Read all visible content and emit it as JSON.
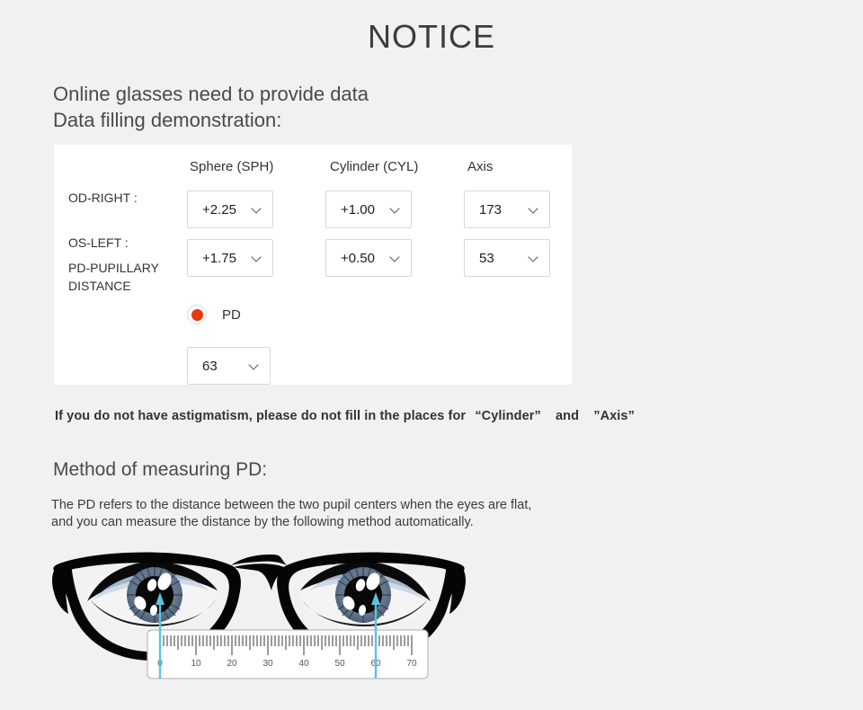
{
  "title": "NOTICE",
  "intro": {
    "line1": "Online glasses need to provide data",
    "line2": "Data filling demonstration:"
  },
  "prescription_form": {
    "columns": [
      {
        "key": "sph",
        "label": "Sphere (SPH)"
      },
      {
        "key": "cyl",
        "label": "Cylinder (CYL)"
      },
      {
        "key": "axis",
        "label": "Axis"
      }
    ],
    "rows": [
      {
        "label": "OD-RIGHT :",
        "sph": "+2.25",
        "cyl": "+1.00",
        "axis": "173"
      },
      {
        "label": "OS-LEFT :",
        "sph": "+1.75",
        "cyl": "+0.50",
        "axis": "53"
      }
    ],
    "pd": {
      "label": "PD-PUPILLARY DISTANCE",
      "radio_label": "PD",
      "radio_selected": true,
      "radio_color": "#e8380d",
      "value": "63"
    },
    "dropdown_icon": "chevron-down-icon",
    "panel_background": "#ffffff"
  },
  "note": {
    "text_before": "If you do not have astigmatism, please do not fill in the places for",
    "quoted_first": "“Cylinder”",
    "conjunction": "and",
    "quoted_second": "”Axis”"
  },
  "method": {
    "heading": "Method of measuring PD:",
    "desc_line1": "The PD refers to the distance between the two pupil centers when the eyes are flat,",
    "desc_line2": "and you can measure the distance by the following method automatically."
  },
  "illustration": {
    "name": "pd-measurement-diagram",
    "description": "Eyeglasses over two eyes with a ruler measuring pupil distance",
    "ruler_labels": [
      "0",
      "10",
      "20",
      "30",
      "40",
      "50",
      "60",
      "70"
    ],
    "measure_line_color": "#5bc4e0",
    "frame_color": "#050505",
    "iris_color": "#5c6f85",
    "ruler_background": "#ffffff",
    "left_marker_value": "0",
    "right_marker_value": "60"
  },
  "theme": {
    "page_background": "#f1f1f1",
    "text_color": "#3a3a3a",
    "border_color": "#d8d8d8"
  }
}
